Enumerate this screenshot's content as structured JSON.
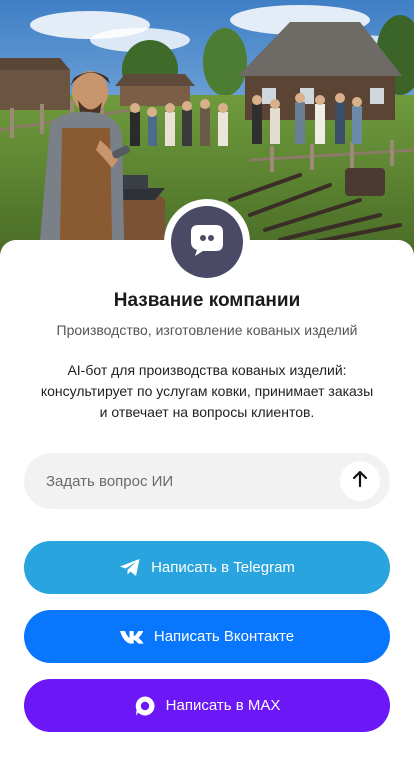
{
  "company": {
    "name": "Название компании",
    "subtitle": "Производство, изготовление кованых изделий",
    "description": "AI-бот для производства кованых изделий: консультирует по услугам ковки, принимает заказы и отвечает на вопросы клиентов."
  },
  "ask": {
    "placeholder": "Задать вопрос ИИ",
    "value": ""
  },
  "buttons": {
    "telegram_label": "Написать в Telegram",
    "vk_label": "Написать Вконтакте",
    "max_label": "Написать в MAX"
  },
  "colors": {
    "telegram": "#29a4df",
    "vk": "#0877fd",
    "max": "#6c17f6",
    "avatar": "#4a4a66"
  },
  "icons": {
    "avatar": "chat-bot-icon",
    "send": "arrow-up-icon",
    "telegram": "telegram-icon",
    "vk": "vk-icon",
    "max": "max-icon"
  }
}
